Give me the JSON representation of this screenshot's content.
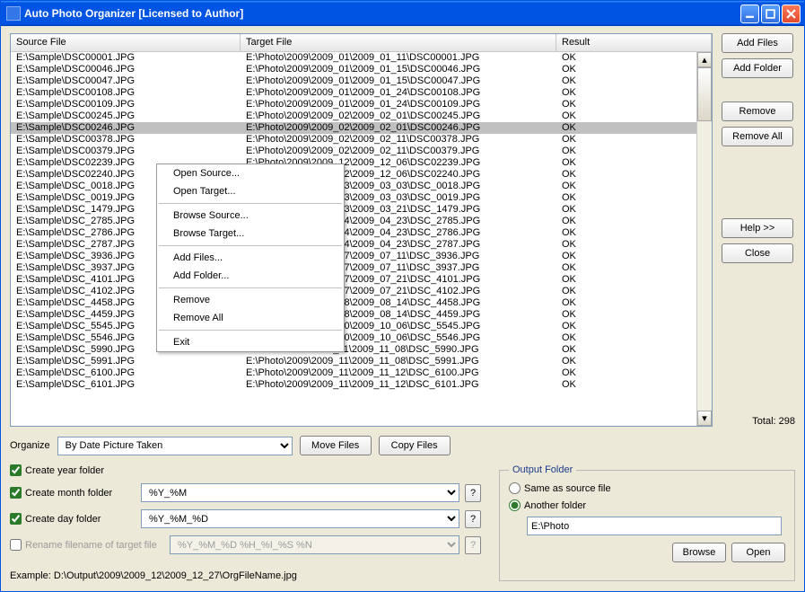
{
  "window": {
    "title": "Auto Photo Organizer [Licensed to Author]"
  },
  "table": {
    "headers": {
      "source": "Source File",
      "target": "Target File",
      "result": "Result"
    },
    "selected_index": 6,
    "rows": [
      {
        "src": "E:\\Sample\\DSC00001.JPG",
        "tgt": "E:\\Photo\\2009\\2009_01\\2009_01_11\\DSC00001.JPG",
        "res": "OK"
      },
      {
        "src": "E:\\Sample\\DSC00046.JPG",
        "tgt": "E:\\Photo\\2009\\2009_01\\2009_01_15\\DSC00046.JPG",
        "res": "OK"
      },
      {
        "src": "E:\\Sample\\DSC00047.JPG",
        "tgt": "E:\\Photo\\2009\\2009_01\\2009_01_15\\DSC00047.JPG",
        "res": "OK"
      },
      {
        "src": "E:\\Sample\\DSC00108.JPG",
        "tgt": "E:\\Photo\\2009\\2009_01\\2009_01_24\\DSC00108.JPG",
        "res": "OK"
      },
      {
        "src": "E:\\Sample\\DSC00109.JPG",
        "tgt": "E:\\Photo\\2009\\2009_01\\2009_01_24\\DSC00109.JPG",
        "res": "OK"
      },
      {
        "src": "E:\\Sample\\DSC00245.JPG",
        "tgt": "E:\\Photo\\2009\\2009_02\\2009_02_01\\DSC00245.JPG",
        "res": "OK"
      },
      {
        "src": "E:\\Sample\\DSC00246.JPG",
        "tgt": "E:\\Photo\\2009\\2009_02\\2009_02_01\\DSC00246.JPG",
        "res": "OK"
      },
      {
        "src": "E:\\Sample\\DSC00378.JPG",
        "tgt": "E:\\Photo\\2009\\2009_02\\2009_02_11\\DSC00378.JPG",
        "res": "OK"
      },
      {
        "src": "E:\\Sample\\DSC00379.JPG",
        "tgt": "E:\\Photo\\2009\\2009_02\\2009_02_11\\DSC00379.JPG",
        "res": "OK"
      },
      {
        "src": "E:\\Sample\\DSC02239.JPG",
        "tgt": "E:\\Photo\\2009\\2009_12\\2009_12_06\\DSC02239.JPG",
        "res": "OK"
      },
      {
        "src": "E:\\Sample\\DSC02240.JPG",
        "tgt": "E:\\Photo\\2009\\2009_12\\2009_12_06\\DSC02240.JPG",
        "res": "OK"
      },
      {
        "src": "E:\\Sample\\DSC_0018.JPG",
        "tgt": "E:\\Photo\\2009\\2009_03\\2009_03_03\\DSC_0018.JPG",
        "res": "OK"
      },
      {
        "src": "E:\\Sample\\DSC_0019.JPG",
        "tgt": "E:\\Photo\\2009\\2009_03\\2009_03_03\\DSC_0019.JPG",
        "res": "OK"
      },
      {
        "src": "E:\\Sample\\DSC_1479.JPG",
        "tgt": "E:\\Photo\\2009\\2009_03\\2009_03_21\\DSC_1479.JPG",
        "res": "OK"
      },
      {
        "src": "E:\\Sample\\DSC_2785.JPG",
        "tgt": "E:\\Photo\\2009\\2009_04\\2009_04_23\\DSC_2785.JPG",
        "res": "OK"
      },
      {
        "src": "E:\\Sample\\DSC_2786.JPG",
        "tgt": "E:\\Photo\\2009\\2009_04\\2009_04_23\\DSC_2786.JPG",
        "res": "OK"
      },
      {
        "src": "E:\\Sample\\DSC_2787.JPG",
        "tgt": "E:\\Photo\\2009\\2009_04\\2009_04_23\\DSC_2787.JPG",
        "res": "OK"
      },
      {
        "src": "E:\\Sample\\DSC_3936.JPG",
        "tgt": "E:\\Photo\\2009\\2009_07\\2009_07_11\\DSC_3936.JPG",
        "res": "OK"
      },
      {
        "src": "E:\\Sample\\DSC_3937.JPG",
        "tgt": "E:\\Photo\\2009\\2009_07\\2009_07_11\\DSC_3937.JPG",
        "res": "OK"
      },
      {
        "src": "E:\\Sample\\DSC_4101.JPG",
        "tgt": "E:\\Photo\\2009\\2009_07\\2009_07_21\\DSC_4101.JPG",
        "res": "OK"
      },
      {
        "src": "E:\\Sample\\DSC_4102.JPG",
        "tgt": "E:\\Photo\\2009\\2009_07\\2009_07_21\\DSC_4102.JPG",
        "res": "OK"
      },
      {
        "src": "E:\\Sample\\DSC_4458.JPG",
        "tgt": "E:\\Photo\\2009\\2009_08\\2009_08_14\\DSC_4458.JPG",
        "res": "OK"
      },
      {
        "src": "E:\\Sample\\DSC_4459.JPG",
        "tgt": "E:\\Photo\\2009\\2009_08\\2009_08_14\\DSC_4459.JPG",
        "res": "OK"
      },
      {
        "src": "E:\\Sample\\DSC_5545.JPG",
        "tgt": "E:\\Photo\\2009\\2009_10\\2009_10_06\\DSC_5545.JPG",
        "res": "OK"
      },
      {
        "src": "E:\\Sample\\DSC_5546.JPG",
        "tgt": "E:\\Photo\\2009\\2009_10\\2009_10_06\\DSC_5546.JPG",
        "res": "OK"
      },
      {
        "src": "E:\\Sample\\DSC_5990.JPG",
        "tgt": "E:\\Photo\\2009\\2009_11\\2009_11_08\\DSC_5990.JPG",
        "res": "OK"
      },
      {
        "src": "E:\\Sample\\DSC_5991.JPG",
        "tgt": "E:\\Photo\\2009\\2009_11\\2009_11_08\\DSC_5991.JPG",
        "res": "OK"
      },
      {
        "src": "E:\\Sample\\DSC_6100.JPG",
        "tgt": "E:\\Photo\\2009\\2009_11\\2009_11_12\\DSC_6100.JPG",
        "res": "OK"
      },
      {
        "src": "E:\\Sample\\DSC_6101.JPG",
        "tgt": "E:\\Photo\\2009\\2009_11\\2009_11_12\\DSC_6101.JPG",
        "res": "OK"
      }
    ]
  },
  "context_menu": {
    "items": [
      {
        "label": "Open Source...",
        "sep": false
      },
      {
        "label": "Open Target...",
        "sep": false
      },
      {
        "sep": true
      },
      {
        "label": "Browse Source...",
        "sep": false
      },
      {
        "label": "Browse Target...",
        "sep": false
      },
      {
        "sep": true
      },
      {
        "label": "Add Files...",
        "sep": false
      },
      {
        "label": "Add Folder...",
        "sep": false
      },
      {
        "sep": true
      },
      {
        "label": "Remove",
        "sep": false
      },
      {
        "label": "Remove All",
        "sep": false
      },
      {
        "sep": true
      },
      {
        "label": "Exit",
        "sep": false
      }
    ]
  },
  "side": {
    "add_files": "Add Files",
    "add_folder": "Add Folder",
    "remove": "Remove",
    "remove_all": "Remove All",
    "help": "Help >>",
    "close": "Close",
    "total": "Total: 298"
  },
  "organize": {
    "label": "Organize",
    "value": "By Date Picture Taken",
    "move": "Move Files",
    "copy": "Copy Files"
  },
  "options": {
    "year": {
      "label": "Create year folder",
      "checked": true
    },
    "month": {
      "label": "Create month folder",
      "checked": true,
      "fmt": "%Y_%M"
    },
    "day": {
      "label": "Create day folder",
      "checked": true,
      "fmt": "%Y_%M_%D"
    },
    "rename": {
      "label": "Rename filename of target file",
      "checked": false,
      "fmt": "%Y_%M_%D %H_%I_%S %N"
    }
  },
  "output": {
    "legend": "Output Folder",
    "same": "Same as source file",
    "another": "Another folder",
    "path": "E:\\Photo",
    "browse": "Browse",
    "open": "Open"
  },
  "example": "Example: D:\\Output\\2009\\2009_12\\2009_12_27\\OrgFileName.jpg"
}
